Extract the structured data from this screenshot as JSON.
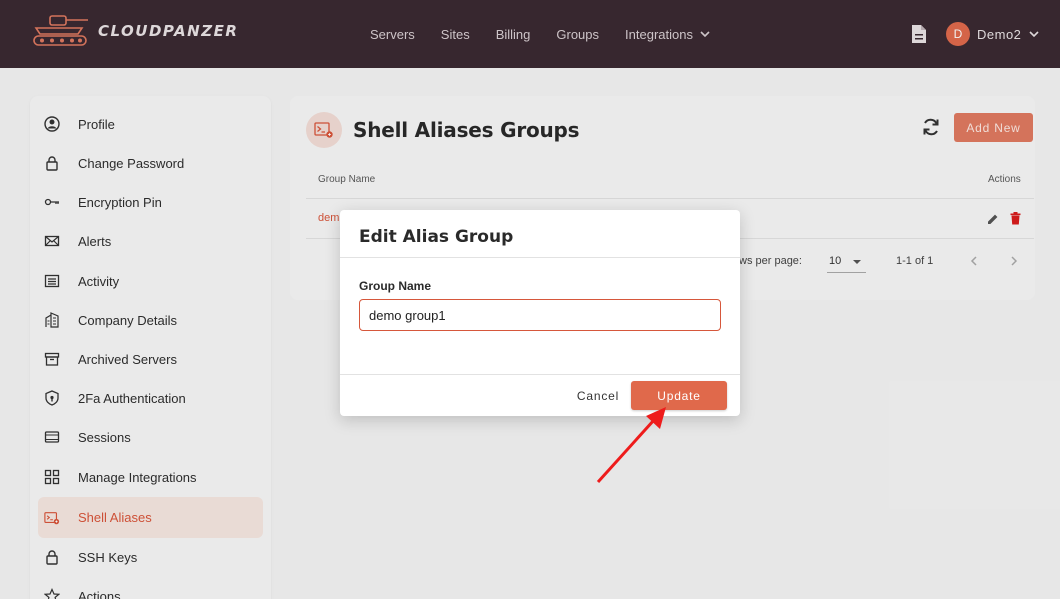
{
  "brand": {
    "name": "CLOUDPANZER"
  },
  "nav": {
    "items": [
      "Servers",
      "Sites",
      "Billing",
      "Groups",
      "Integrations"
    ]
  },
  "user": {
    "initial": "D",
    "name": "Demo2"
  },
  "sidebar": {
    "items": [
      {
        "label": "Profile",
        "icon": "user-circle-icon"
      },
      {
        "label": "Change Password",
        "icon": "lock-icon"
      },
      {
        "label": "Encryption Pin",
        "icon": "key-icon"
      },
      {
        "label": "Alerts",
        "icon": "envelope-icon"
      },
      {
        "label": "Activity",
        "icon": "list-icon"
      },
      {
        "label": "Company Details",
        "icon": "building-icon"
      },
      {
        "label": "Archived Servers",
        "icon": "archive-icon"
      },
      {
        "label": "2Fa Authentication",
        "icon": "shield-icon"
      },
      {
        "label": "Sessions",
        "icon": "sessions-icon"
      },
      {
        "label": "Manage Integrations",
        "icon": "grid-icon"
      },
      {
        "label": "Shell Aliases",
        "icon": "terminal-icon",
        "active": true
      },
      {
        "label": "SSH Keys",
        "icon": "lock-icon"
      },
      {
        "label": "Actions",
        "icon": "star-icon"
      }
    ]
  },
  "main": {
    "title": "Shell Aliases Groups",
    "add_button": "Add New",
    "table": {
      "columns": [
        "Group Name",
        "Actions"
      ],
      "rows": [
        {
          "group_name": "dem"
        }
      ]
    },
    "pagination": {
      "rows_per_page_label": "ws per page:",
      "rows_per_page": "10",
      "range": "1-1 of 1"
    }
  },
  "modal": {
    "title": "Edit Alias Group",
    "field_label": "Group Name",
    "field_value": "demo group1",
    "cancel": "Cancel",
    "update": "Update"
  },
  "colors": {
    "topbar": "#3a2a32",
    "accent": "#e0694b",
    "active_bg": "#f6e7e1",
    "arrow": "#ee1c1c"
  }
}
